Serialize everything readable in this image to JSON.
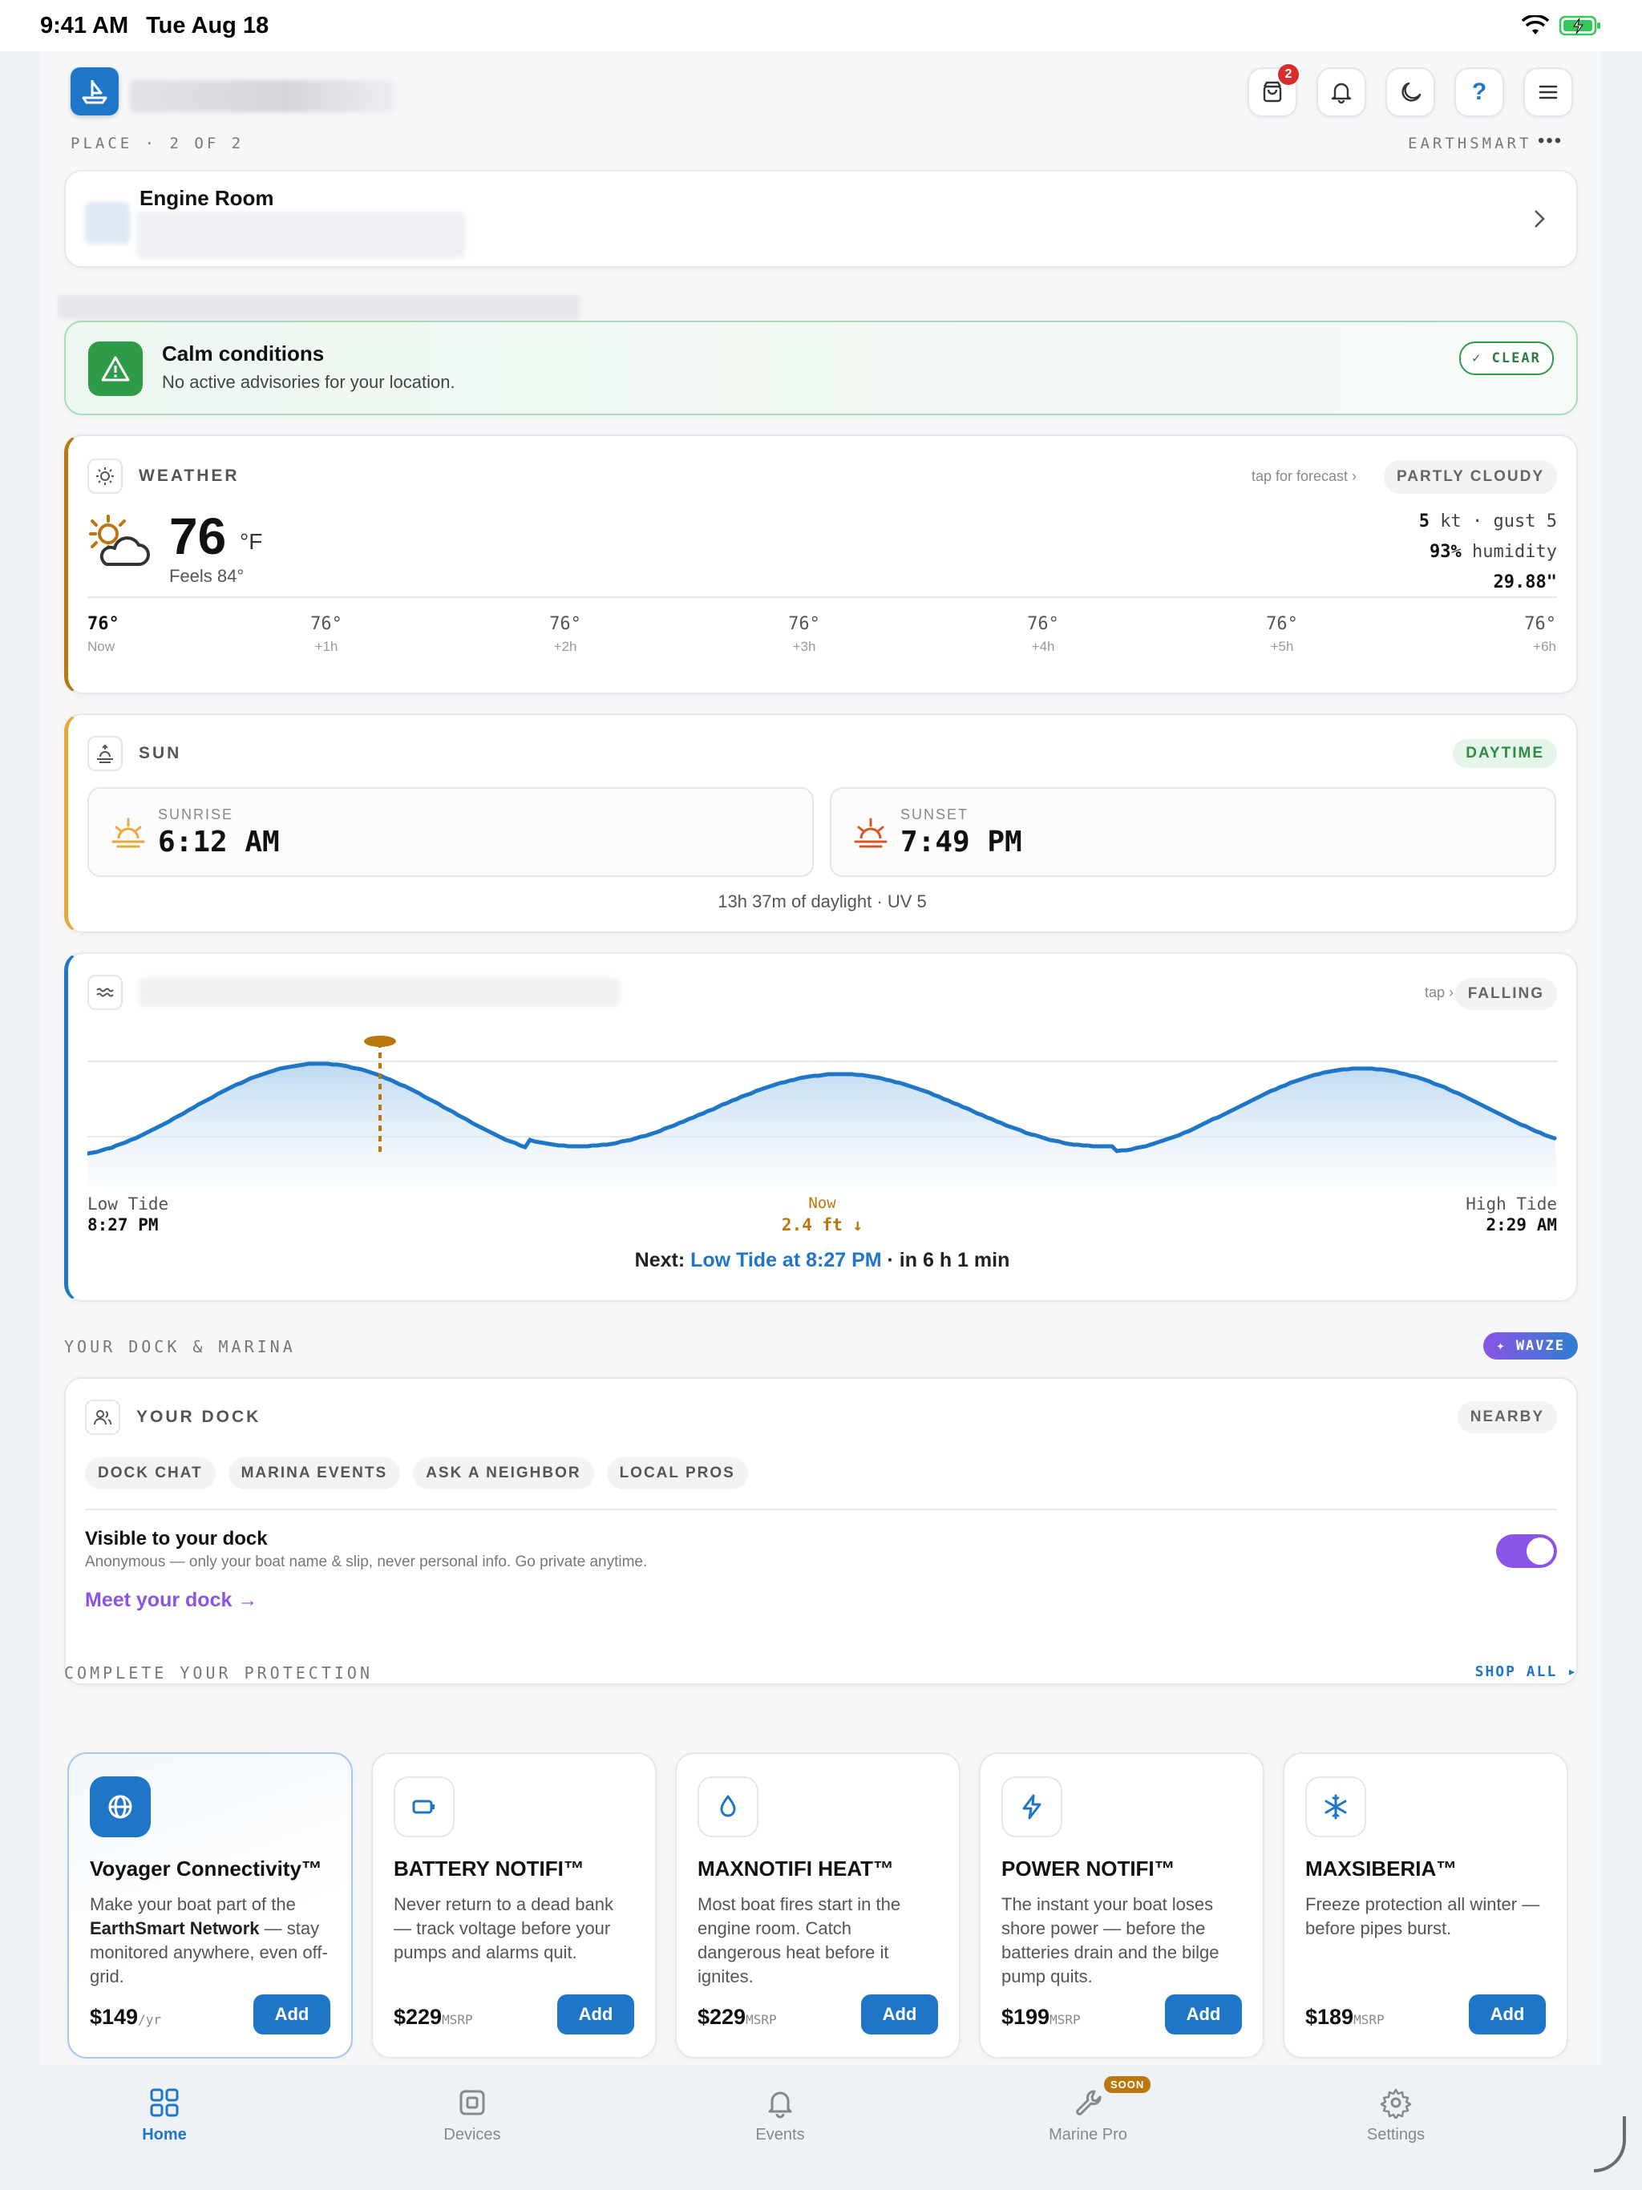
{
  "status": {
    "time": "9:41 AM",
    "date": "Tue Aug 18"
  },
  "header": {
    "cart_count": "2",
    "help_label": "?"
  },
  "place": {
    "label": "PLACE · 2 OF 2",
    "brand": "EARTHSMART",
    "more": "•••"
  },
  "location": {
    "name": "Engine Room"
  },
  "advisory": {
    "title": "Calm conditions",
    "subtitle": "No active advisories for your location.",
    "badge": "✓ CLEAR"
  },
  "weather": {
    "label": "WEATHER",
    "hint": "tap for forecast ›",
    "condition": "PARTLY CLOUDY",
    "temp": "76",
    "unit": "°F",
    "feels": "Feels 84°",
    "wind_value": "5",
    "wind_rest": "kt · gust 5",
    "humidity_value": "93%",
    "humidity_rest": "humidity",
    "pressure": "29.88\"",
    "hourly": [
      {
        "temp": "76°",
        "label": "Now"
      },
      {
        "temp": "76°",
        "label": "+1h"
      },
      {
        "temp": "76°",
        "label": "+2h"
      },
      {
        "temp": "76°",
        "label": "+3h"
      },
      {
        "temp": "76°",
        "label": "+4h"
      },
      {
        "temp": "76°",
        "label": "+5h"
      },
      {
        "temp": "76°",
        "label": "+6h"
      }
    ]
  },
  "sun": {
    "label": "SUN",
    "badge": "DAYTIME",
    "sunrise_label": "SUNRISE",
    "sunrise": "6:12 AM",
    "sunset_label": "SUNSET",
    "sunset": "7:49 PM",
    "footer": "13h 37m of daylight · UV 5"
  },
  "tide": {
    "hint": "tap ›",
    "status": "FALLING",
    "low_label": "Low Tide",
    "low_time": "8:27 PM",
    "now_label": "Now",
    "now_value": "2.4 ft ↓",
    "high_label": "High Tide",
    "high_time": "2:29 AM",
    "next_prefix": "Next: ",
    "next_event": "Low Tide at 8:27 PM",
    "next_suffix": " · in 6 h 1 min"
  },
  "dock_section": {
    "label": "YOUR DOCK & MARINA",
    "badge": "✦ WAVZE"
  },
  "dock": {
    "label": "YOUR DOCK",
    "badge": "NEARBY",
    "chips": [
      "DOCK CHAT",
      "MARINA EVENTS",
      "ASK A NEIGHBOR",
      "LOCAL PROS"
    ],
    "visible_title": "Visible to your dock",
    "visible_sub": "Anonymous — only your boat name & slip, never personal info. Go private anytime.",
    "visible_on": true,
    "link": "Meet your dock →"
  },
  "protection": {
    "label": "COMPLETE YOUR PROTECTION",
    "shop": "SHOP ALL ▸",
    "products": [
      {
        "name": "Voyager Connectivity™",
        "desc_a": "Make your boat part of the ",
        "desc_b": "EarthSmart Network",
        "desc_c": " — stay monitored anywhere, even off-grid.",
        "price": "$149",
        "unit": "/yr",
        "add": "Add"
      },
      {
        "name": "BATTERY NOTIFI™",
        "desc_a": "Never return to a dead bank — track voltage before your pumps and alarms quit.",
        "desc_b": "",
        "desc_c": "",
        "price": "$229",
        "unit": "MSRP",
        "add": "Add"
      },
      {
        "name": "MAXNOTIFI HEAT™",
        "desc_a": "Most boat fires start in the engine room. Catch dangerous heat before it ignites.",
        "desc_b": "",
        "desc_c": "",
        "price": "$229",
        "unit": "MSRP",
        "add": "Add"
      },
      {
        "name": "POWER NOTIFI™",
        "desc_a": "The instant your boat loses shore power — before the batteries drain and the bilge pump quits.",
        "desc_b": "",
        "desc_c": "",
        "price": "$199",
        "unit": "MSRP",
        "add": "Add"
      },
      {
        "name": "MAXSIBERIA™",
        "desc_a": "Freeze protection all winter — before pipes burst.",
        "desc_b": "",
        "desc_c": "",
        "price": "$189",
        "unit": "MSRP",
        "add": "Add"
      }
    ]
  },
  "tabs": [
    {
      "label": "Home"
    },
    {
      "label": "Devices"
    },
    {
      "label": "Events"
    },
    {
      "label": "Marine Pro",
      "badge": "SOON"
    },
    {
      "label": "Settings"
    }
  ],
  "colors": {
    "accent": "#1f76c7",
    "green": "#2e9b48",
    "purple": "#8a54e6",
    "tide_orange": "#b9770e"
  }
}
